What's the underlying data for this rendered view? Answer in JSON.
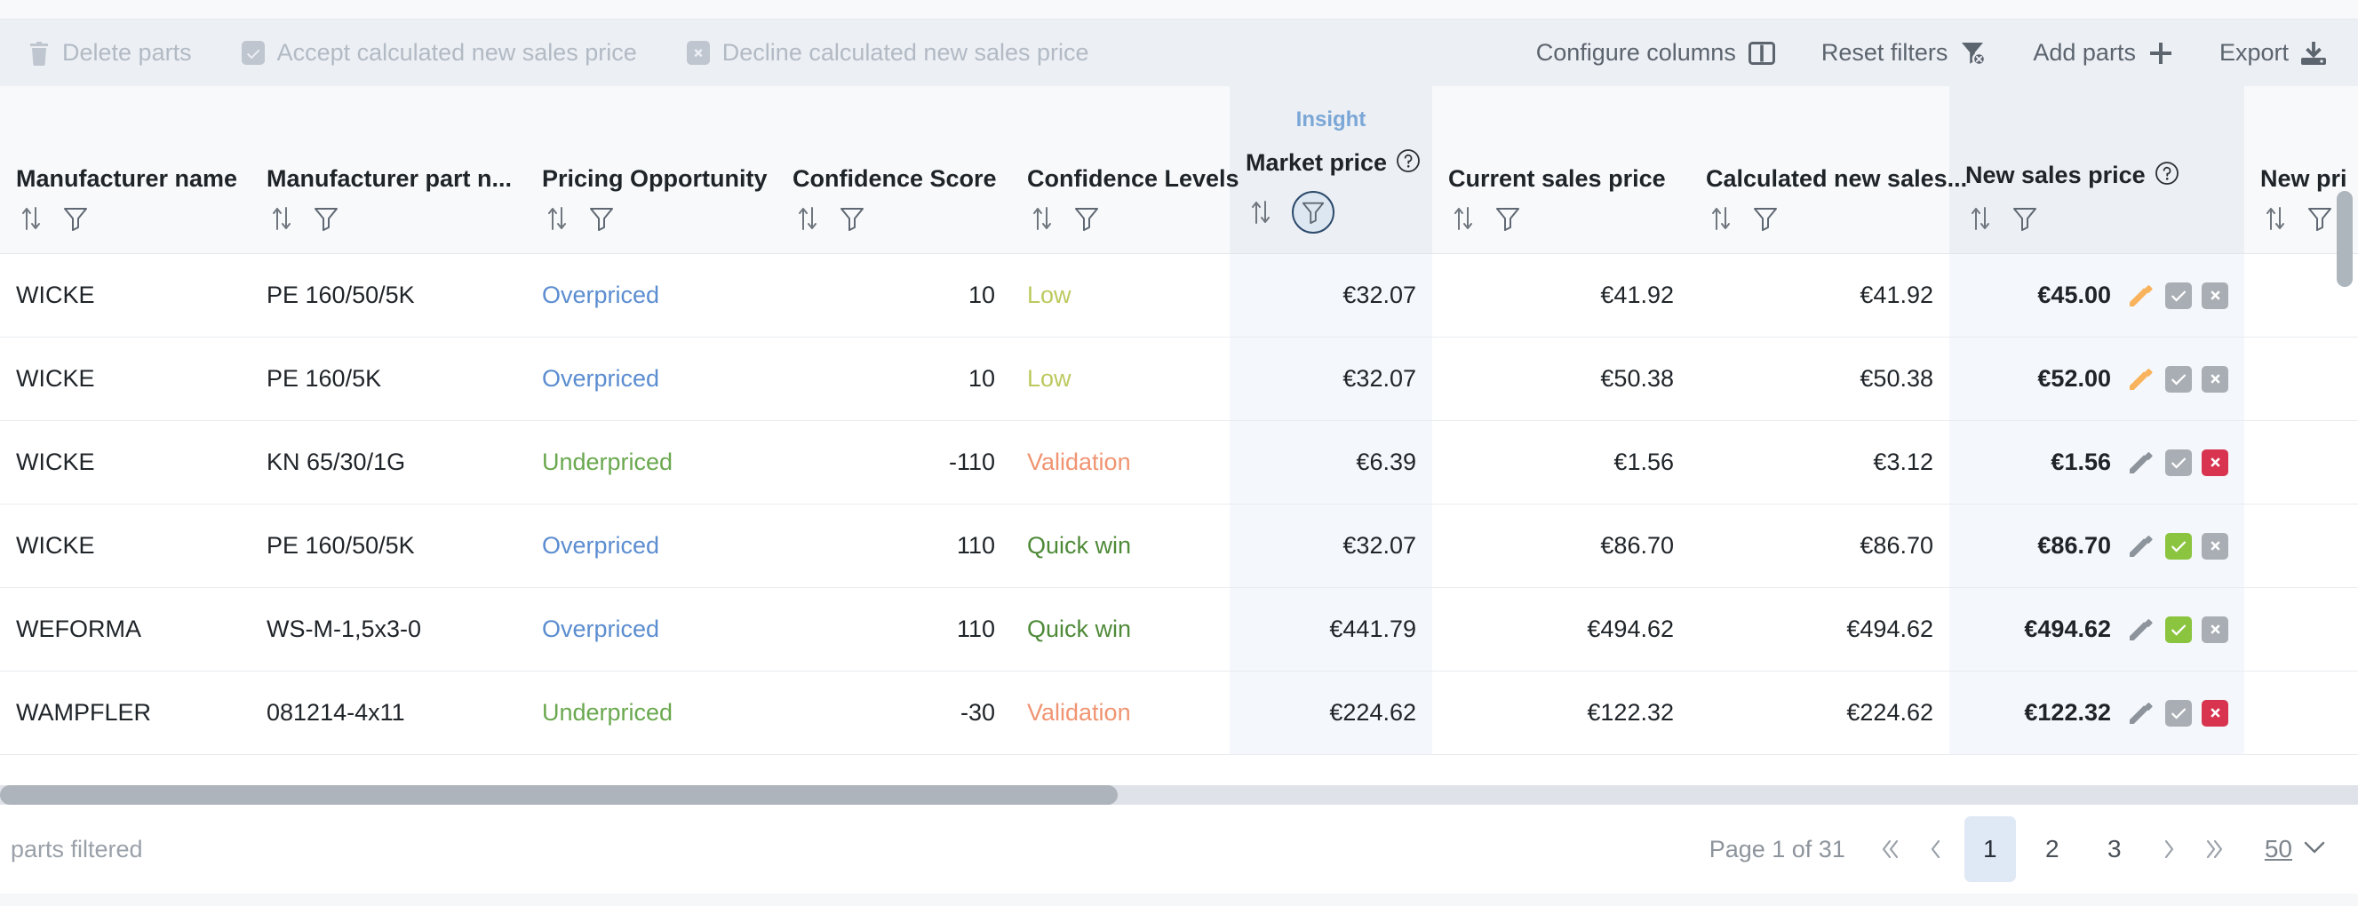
{
  "toolbar": {
    "left_actions": [
      {
        "label": "Delete parts",
        "icon": "trash-icon",
        "enabled": false
      },
      {
        "label": "Accept calculated new sales price",
        "icon": "checkbox-icon",
        "enabled": false
      },
      {
        "label": "Decline calculated new sales price",
        "icon": "close-box-icon",
        "enabled": false
      }
    ],
    "right_actions": [
      {
        "label": "Configure columns",
        "icon": "columns-icon",
        "enabled": true
      },
      {
        "label": "Reset filters",
        "icon": "filter-off-icon",
        "enabled": true
      },
      {
        "label": "Add parts",
        "icon": "plus-icon",
        "enabled": true
      },
      {
        "label": "Export",
        "icon": "download-icon",
        "enabled": true
      }
    ]
  },
  "table": {
    "columns": [
      {
        "key": "manufacturer_name",
        "label": "Manufacturer name",
        "align": "left",
        "tinted": false,
        "has_help": false,
        "overline": "",
        "filter_active": false
      },
      {
        "key": "manufacturer_part_number",
        "label": "Manufacturer part n...",
        "align": "left",
        "tinted": false,
        "has_help": false,
        "overline": "",
        "filter_active": false
      },
      {
        "key": "pricing_opportunity",
        "label": "Pricing Opportunity",
        "align": "left",
        "tinted": false,
        "has_help": false,
        "overline": "",
        "filter_active": false
      },
      {
        "key": "confidence_score",
        "label": "Confidence Score",
        "align": "right",
        "tinted": false,
        "has_help": false,
        "overline": "",
        "filter_active": false
      },
      {
        "key": "confidence_levels",
        "label": "Confidence Levels",
        "align": "left",
        "tinted": false,
        "has_help": false,
        "overline": "",
        "filter_active": false
      },
      {
        "key": "market_price",
        "label": "Market price",
        "align": "right",
        "tinted": true,
        "has_help": true,
        "overline": "Insight",
        "filter_active": true
      },
      {
        "key": "current_sales_price",
        "label": "Current sales price",
        "align": "right",
        "tinted": false,
        "has_help": false,
        "overline": "",
        "filter_active": false
      },
      {
        "key": "calculated_new_sales_price",
        "label": "Calculated new sales...",
        "align": "right",
        "tinted": false,
        "has_help": false,
        "overline": "",
        "filter_active": false
      },
      {
        "key": "new_sales_price",
        "label": "New sales price",
        "align": "right",
        "tinted": true,
        "has_help": true,
        "overline": "",
        "filter_active": false
      },
      {
        "key": "new_price_partial",
        "label": "New pri",
        "align": "right",
        "tinted": false,
        "has_help": false,
        "overline": "",
        "filter_active": false
      }
    ],
    "rows": [
      {
        "manufacturer_name": "WICKE",
        "manufacturer_part_number": "PE 160/50/5K",
        "pricing_opportunity": "Overpriced",
        "pricing_opportunity_kind": "over",
        "confidence_score": "10",
        "confidence_levels": "Low",
        "confidence_levels_kind": "low",
        "market_price": "€32.07",
        "current_sales_price": "€41.92",
        "calculated_new_sales_price": "€41.92",
        "new_sales_price": "€45.00",
        "edit_state": "edited",
        "accept_state": "inactive",
        "decline_state": "inactive"
      },
      {
        "manufacturer_name": "WICKE",
        "manufacturer_part_number": "PE 160/5K",
        "pricing_opportunity": "Overpriced",
        "pricing_opportunity_kind": "over",
        "confidence_score": "10",
        "confidence_levels": "Low",
        "confidence_levels_kind": "low",
        "market_price": "€32.07",
        "current_sales_price": "€50.38",
        "calculated_new_sales_price": "€50.38",
        "new_sales_price": "€52.00",
        "edit_state": "edited",
        "accept_state": "inactive",
        "decline_state": "inactive"
      },
      {
        "manufacturer_name": "WICKE",
        "manufacturer_part_number": "KN 65/30/1G",
        "pricing_opportunity": "Underpriced",
        "pricing_opportunity_kind": "under",
        "confidence_score": "-110",
        "confidence_levels": "Validation",
        "confidence_levels_kind": "validation",
        "market_price": "€6.39",
        "current_sales_price": "€1.56",
        "calculated_new_sales_price": "€3.12",
        "new_sales_price": "€1.56",
        "edit_state": "default",
        "accept_state": "inactive",
        "decline_state": "active"
      },
      {
        "manufacturer_name": "WICKE",
        "manufacturer_part_number": "PE 160/50/5K",
        "pricing_opportunity": "Overpriced",
        "pricing_opportunity_kind": "over",
        "confidence_score": "110",
        "confidence_levels": "Quick win",
        "confidence_levels_kind": "quick",
        "market_price": "€32.07",
        "current_sales_price": "€86.70",
        "calculated_new_sales_price": "€86.70",
        "new_sales_price": "€86.70",
        "edit_state": "default",
        "accept_state": "active",
        "decline_state": "inactive"
      },
      {
        "manufacturer_name": "WEFORMA",
        "manufacturer_part_number": "WS-M-1,5x3-0",
        "pricing_opportunity": "Overpriced",
        "pricing_opportunity_kind": "over",
        "confidence_score": "110",
        "confidence_levels": "Quick win",
        "confidence_levels_kind": "quick",
        "market_price": "€441.79",
        "current_sales_price": "€494.62",
        "calculated_new_sales_price": "€494.62",
        "new_sales_price": "€494.62",
        "edit_state": "default",
        "accept_state": "active",
        "decline_state": "inactive"
      },
      {
        "manufacturer_name": "WAMPFLER",
        "manufacturer_part_number": "081214-4x11",
        "pricing_opportunity": "Underpriced",
        "pricing_opportunity_kind": "under",
        "confidence_score": "-30",
        "confidence_levels": "Validation",
        "confidence_levels_kind": "validation",
        "market_price": "€224.62",
        "current_sales_price": "€122.32",
        "calculated_new_sales_price": "€224.62",
        "new_sales_price": "€122.32",
        "edit_state": "default",
        "accept_state": "inactive",
        "decline_state": "active"
      }
    ]
  },
  "footer": {
    "filtered_text": "parts filtered",
    "page_label": "Page 1 of 31",
    "first_icon": "chevron-double-left-icon",
    "prev_icon": "chevron-left-icon",
    "pages": [
      "1",
      "2",
      "3"
    ],
    "active_page": "1",
    "next_icon": "chevron-right-icon",
    "last_icon": "chevron-double-right-icon",
    "page_size": "50",
    "page_size_chevron": "chevron-down-icon"
  },
  "colors": {
    "insight_blue": "#7ba7d7",
    "overpriced": "#5b8dd0",
    "underpriced": "#6aa84f",
    "low": "#bdc95f",
    "validation": "#f09472",
    "quick_win": "#4e8a38",
    "accept_green": "#8bc53f",
    "decline_red": "#d8344f",
    "inactive_grey": "#a9aeb4",
    "edit_orange": "#f9b35c",
    "toolbar_bg": "#eceff4",
    "page_active_bg": "#dfe8f5"
  }
}
